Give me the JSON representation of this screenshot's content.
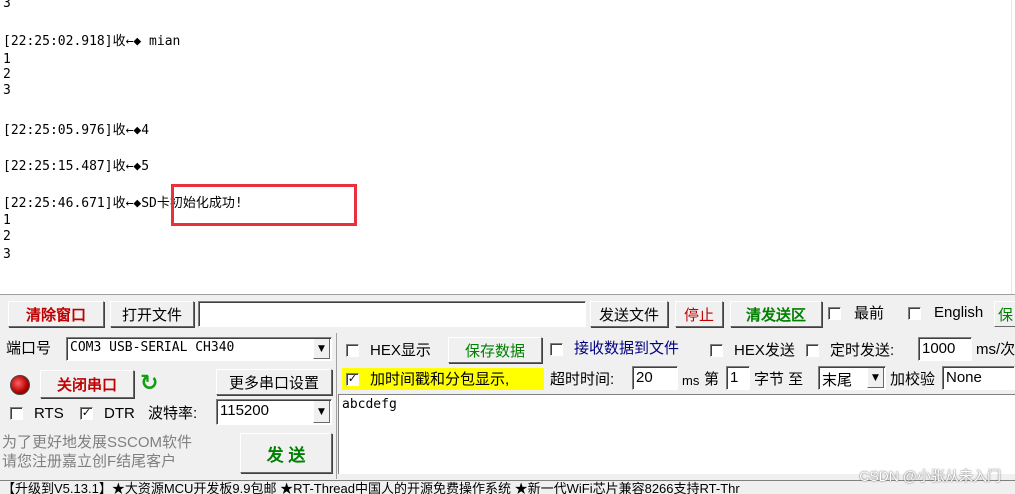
{
  "log": {
    "lines": [
      "3",
      "",
      "[22:25:02.918]收←◆ mian",
      "1",
      "2",
      "3",
      "",
      "",
      "[22:25:05.976]收←◆4",
      "",
      "[22:25:15.487]收←◆5",
      "",
      "[22:25:46.671]收←◆SD卡初始化成功!",
      "1",
      "2",
      "3"
    ]
  },
  "toolbar": {
    "clear_label": "清除窗口",
    "open_file_label": "打开文件",
    "file_path": "",
    "send_file_label": "发送文件",
    "stop_label": "停止",
    "clear_send_label": "清发送区",
    "topmost_label": "最前",
    "english_label": "English",
    "save_param_label": "保"
  },
  "port": {
    "port_label": "端口号",
    "port_value": "COM3 USB-SERIAL CH340",
    "close_port_label": "关闭串口",
    "more_settings_label": "更多串口设置",
    "rts_label": "RTS",
    "dtr_label": "DTR",
    "baud_label": "波特率:",
    "baud_value": "115200",
    "promo_line1": "为了更好地发展SSCOM软件",
    "promo_line2": "请您注册嘉立创F结尾客户",
    "send_label": "发 送"
  },
  "options": {
    "hex_display_label": "HEX显示",
    "save_data_label": "保存数据",
    "recv_to_file_label": "接收数据到文件",
    "hex_send_label": "HEX发送",
    "timed_send_label": "定时发送:",
    "timed_value": "1000",
    "timed_unit": "ms/次",
    "timestamp_label": "加时间戳和分包显示,",
    "timeout_label": "超时时间:",
    "timeout_value": "20",
    "timeout_unit": "ms",
    "byte_prefix": "第",
    "byte_index": "1",
    "byte_suffix": "字节 至",
    "byte_end": "末尾",
    "checksum_label": "加校验",
    "checksum_value": "None"
  },
  "send_text": "abcdefg",
  "status_bar": "【升级到V5.13.1】★大资源MCU开发板9.9包邮 ★RT-Thread中国人的开源免费操作系统 ★新一代WiFi芯片兼容8266支持RT-Thr",
  "watermark": "CSDN @小张从未入门",
  "colors": {
    "highlight": "#e8313a",
    "red_text": "#c00000",
    "green_text": "#008000",
    "yellow": "#ffff00"
  }
}
